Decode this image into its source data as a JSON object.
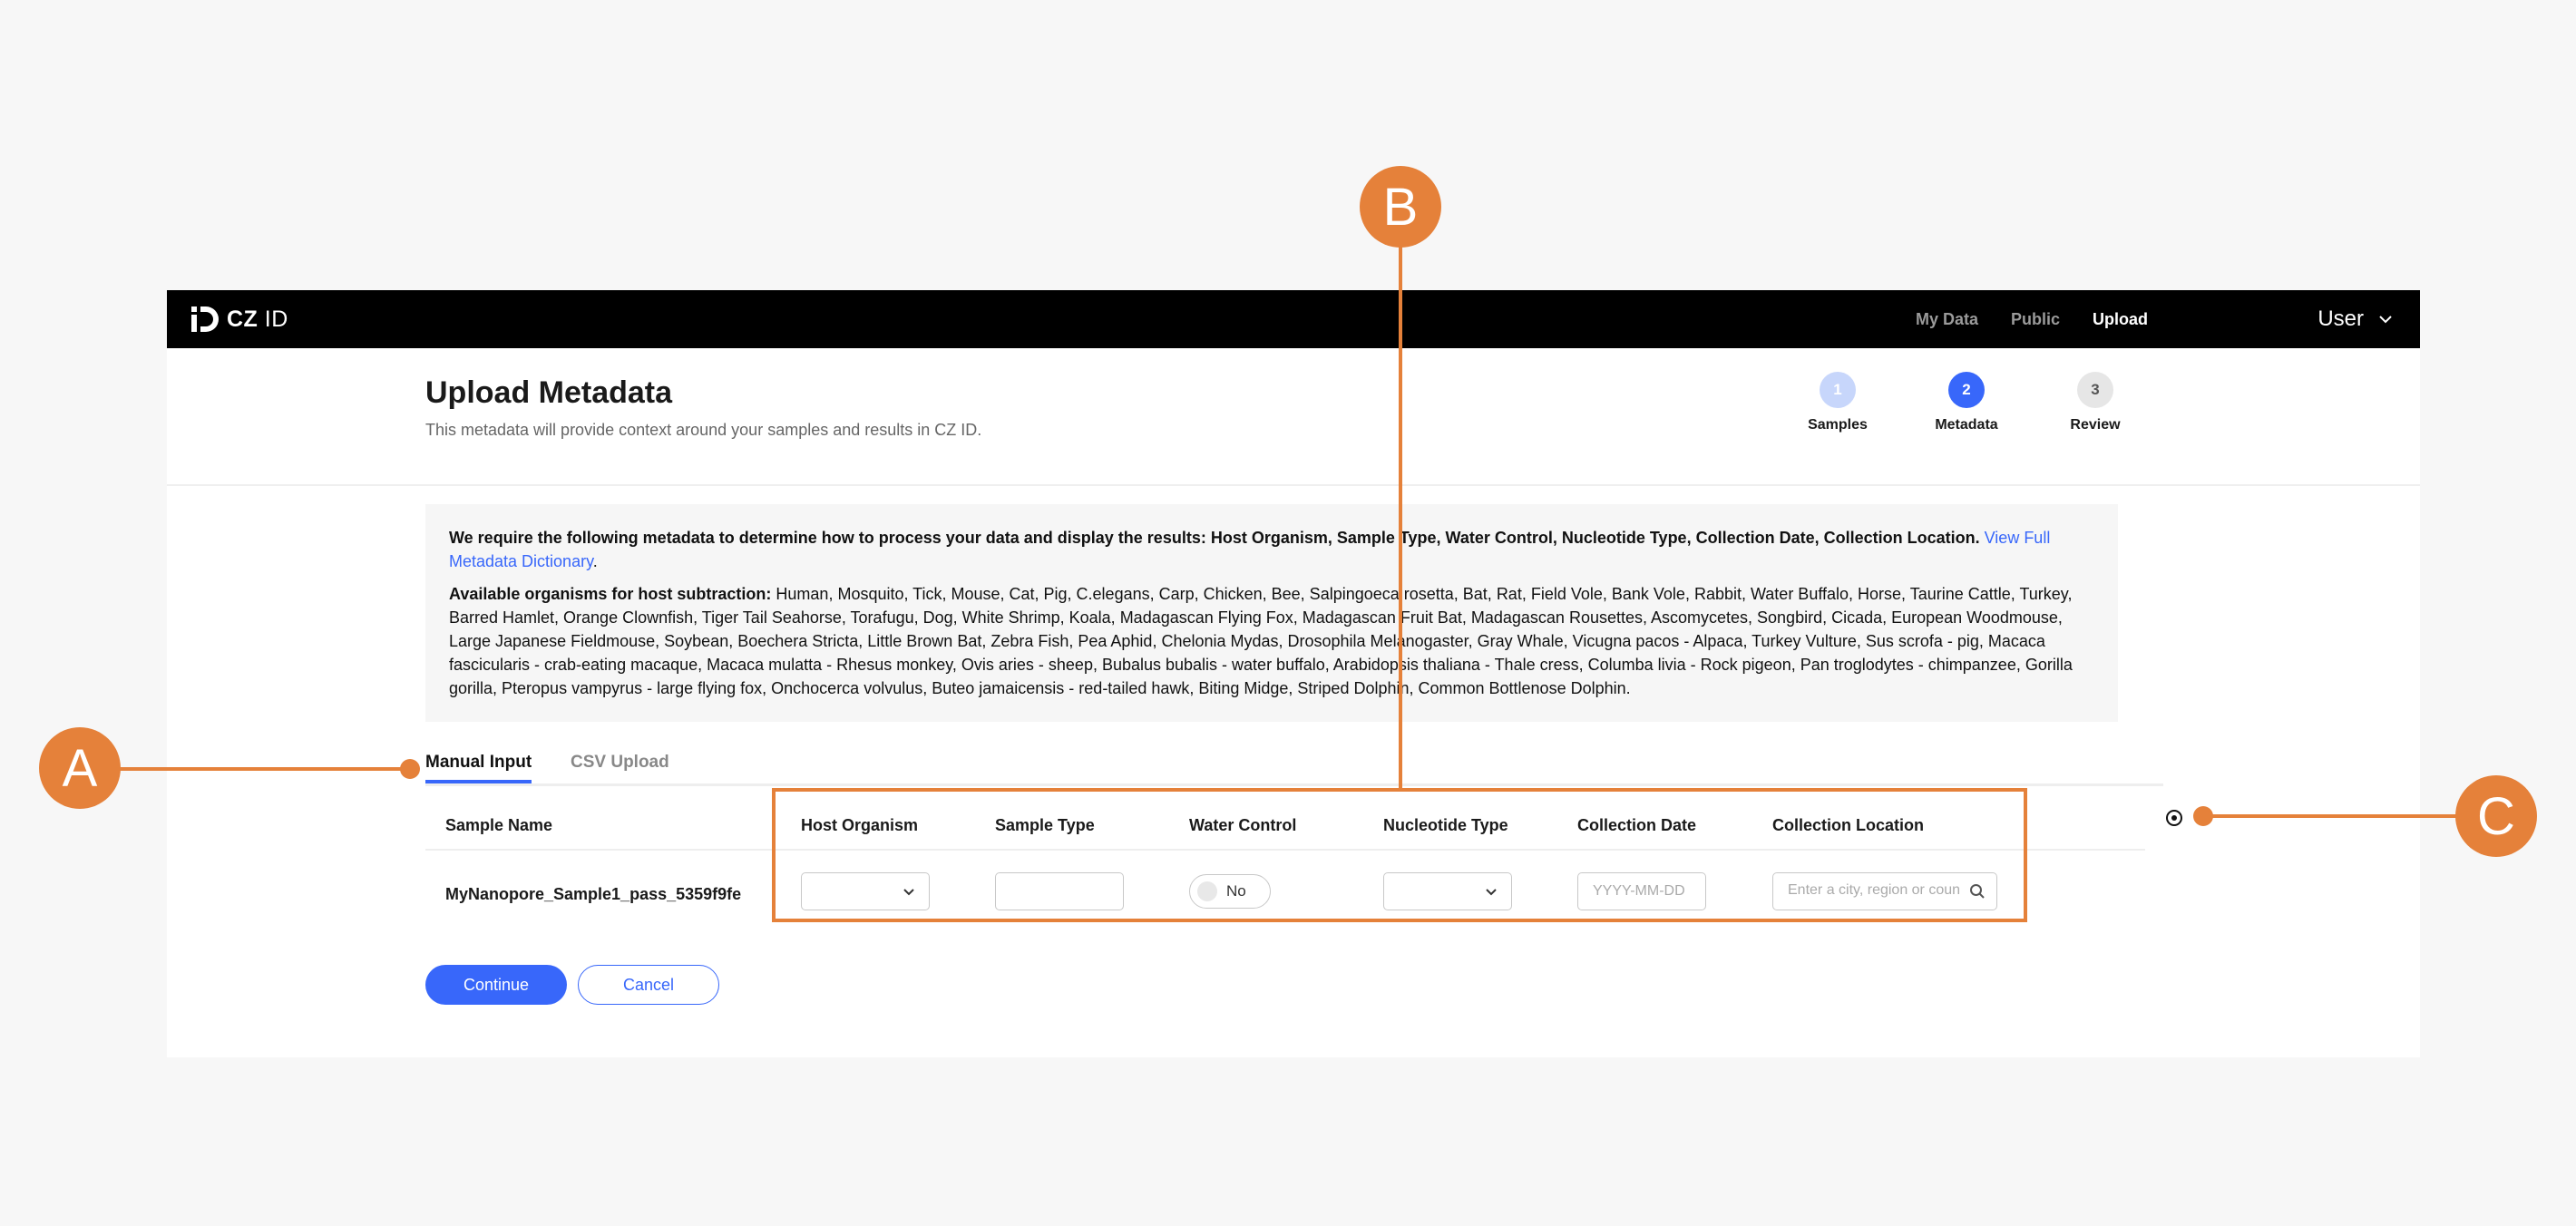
{
  "nav": {
    "brand_bold": "CZ",
    "brand_light": "ID",
    "links": [
      "My Data",
      "Public",
      "Upload"
    ],
    "user": "User"
  },
  "header": {
    "title": "Upload Metadata",
    "subtitle": "This metadata will provide context around your samples and results in CZ ID.",
    "steps": [
      {
        "number": "1",
        "label": "Samples"
      },
      {
        "number": "2",
        "label": "Metadata"
      },
      {
        "number": "3",
        "label": "Review"
      }
    ]
  },
  "info": {
    "required_text": "We require the following metadata to determine how to process your data and display the results: Host Organism, Sample Type, Water Control, Nucleotide Type, Collection Date, Collection Location.",
    "dictionary_link": "View Full Metadata Dictionary",
    "period": ".",
    "organisms_label": "Available organisms for host subtraction:",
    "organisms_list": "Human, Mosquito, Tick, Mouse, Cat, Pig, C.elegans, Carp, Chicken, Bee, Salpingoeca rosetta, Bat, Rat, Field Vole, Bank Vole, Rabbit, Water Buffalo, Horse, Taurine Cattle, Turkey, Barred Hamlet, Orange Clownfish, Tiger Tail Seahorse, Torafugu, Dog, White Shrimp, Koala, Madagascan Flying Fox, Madagascan Fruit Bat, Madagascan Rousettes, Ascomycetes, Songbird, Cicada, European Woodmouse, Large Japanese Fieldmouse, Soybean, Boechera Stricta, Little Brown Bat, Zebra Fish, Pea Aphid, Chelonia Mydas, Drosophila Melanogaster, Gray Whale, Vicugna pacos - Alpaca, Turkey Vulture, Sus scrofa - pig, Macaca fascicularis - crab-eating macaque, Macaca mulatta - Rhesus monkey, Ovis aries - sheep, Bubalus bubalis - water buffalo, Arabidopsis thaliana - Thale cress, Columba livia - Rock pigeon, Pan troglodytes - chimpanzee, Gorilla gorilla, Pteropus vampyrus - large flying fox, Onchocerca volvulus, Buteo jamaicensis - red-tailed hawk, Biting Midge, Striped Dolphin, Common Bottlenose Dolphin."
  },
  "tabs": [
    "Manual Input",
    "CSV Upload"
  ],
  "table": {
    "columns": [
      "Sample Name",
      "Host Organism",
      "Sample Type",
      "Water Control",
      "Nucleotide Type",
      "Collection Date",
      "Collection Location"
    ],
    "row": {
      "sample_name": "MyNanopore_Sample1_pass_5359f9fe",
      "water_control": "No",
      "date_placeholder": "YYYY-MM-DD",
      "location_placeholder": "Enter a city, region or country"
    }
  },
  "buttons": {
    "continue": "Continue",
    "cancel": "Cancel"
  },
  "callouts": {
    "a": "A",
    "b": "B",
    "c": "C"
  },
  "colors": {
    "accent": "#3867fa",
    "callout": "#e5813a",
    "nav_bg": "#000000"
  }
}
